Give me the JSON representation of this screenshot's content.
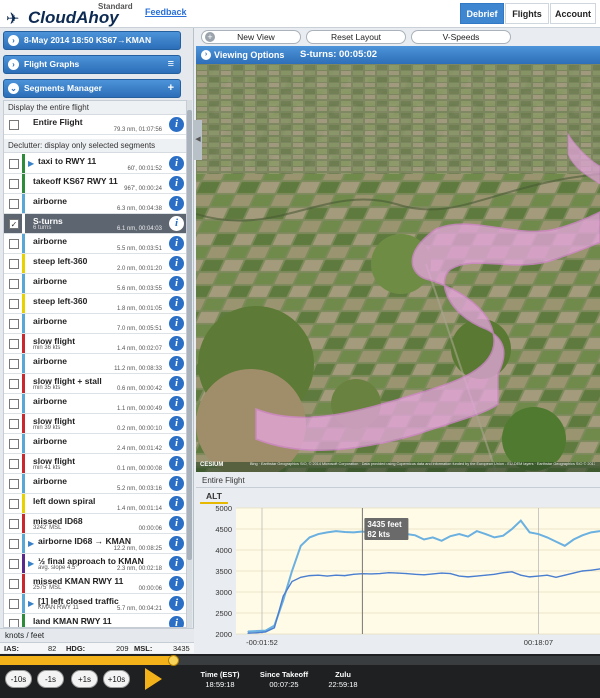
{
  "header": {
    "logo_standard": "Standard",
    "logo_name": "CloudAhoy",
    "feedback": "Feedback",
    "nav": [
      "Debrief",
      "Flights",
      "Account"
    ]
  },
  "left": {
    "flight_bar": "8-May 2014 18:50   KS67→KMAN",
    "graphs_bar": "Flight Graphs",
    "segments_bar": "Segments Manager",
    "display_entire": "Display the entire flight",
    "declutter": "Declutter: display only selected segments",
    "entire": {
      "name": "Entire Flight",
      "stat": "79.3 nm, 01:07:56"
    },
    "segments": [
      {
        "name": "taxi to RWY 11",
        "sub": "",
        "stat": "60', 00:01:52",
        "color": "#2e8b3c",
        "arrow": true,
        "checked": false,
        "selected": false
      },
      {
        "name": "takeoff KS67 RWY 11",
        "sub": "",
        "stat": "967', 00:00:24",
        "color": "#2e8b3c",
        "arrow": false,
        "checked": false,
        "selected": false
      },
      {
        "name": "airborne",
        "sub": "",
        "stat": "6.3 nm, 00:04:38",
        "color": "#5aa7d6",
        "arrow": false,
        "checked": false,
        "selected": false
      },
      {
        "name": "S-turns",
        "sub": "6 turns",
        "stat": "6.1 nm, 00:04:03",
        "color": "#ffffff",
        "arrow": false,
        "checked": true,
        "selected": true
      },
      {
        "name": "airborne",
        "sub": "",
        "stat": "5.5 nm, 00:03:51",
        "color": "#5aa7d6",
        "arrow": false,
        "checked": false,
        "selected": false
      },
      {
        "name": "steep left-360",
        "sub": "",
        "stat": "2.0 nm, 00:01:20",
        "color": "#e8d100",
        "arrow": false,
        "checked": false,
        "selected": false
      },
      {
        "name": "airborne",
        "sub": "",
        "stat": "5.6 nm, 00:03:55",
        "color": "#5aa7d6",
        "arrow": false,
        "checked": false,
        "selected": false
      },
      {
        "name": "steep left-360",
        "sub": "",
        "stat": "1.8 nm, 00:01:05",
        "color": "#e8d100",
        "arrow": false,
        "checked": false,
        "selected": false
      },
      {
        "name": "airborne",
        "sub": "",
        "stat": "7.0 nm, 00:05:51",
        "color": "#5aa7d6",
        "arrow": false,
        "checked": false,
        "selected": false
      },
      {
        "name": "slow flight",
        "sub": "min 36 kts",
        "stat": "1.4 nm, 00:02:07",
        "color": "#c8282e",
        "arrow": false,
        "checked": false,
        "selected": false
      },
      {
        "name": "airborne",
        "sub": "",
        "stat": "11.2 nm, 00:08:33",
        "color": "#5aa7d6",
        "arrow": false,
        "checked": false,
        "selected": false
      },
      {
        "name": "slow flight + stall",
        "sub": "min 35 kts",
        "stat": "0.6 nm, 00:00:42",
        "color": "#c8282e",
        "arrow": false,
        "checked": false,
        "selected": false
      },
      {
        "name": "airborne",
        "sub": "",
        "stat": "1.1 nm, 00:00:49",
        "color": "#5aa7d6",
        "arrow": false,
        "checked": false,
        "selected": false
      },
      {
        "name": "slow flight",
        "sub": "min 39 kts",
        "stat": "0.2 nm, 00:00:10",
        "color": "#c8282e",
        "arrow": false,
        "checked": false,
        "selected": false
      },
      {
        "name": "airborne",
        "sub": "",
        "stat": "2.4 nm, 00:01:42",
        "color": "#5aa7d6",
        "arrow": false,
        "checked": false,
        "selected": false
      },
      {
        "name": "slow flight",
        "sub": "min 41 kts",
        "stat": "0.1 nm, 00:00:08",
        "color": "#c8282e",
        "arrow": false,
        "checked": false,
        "selected": false
      },
      {
        "name": "airborne",
        "sub": "",
        "stat": "5.2 nm, 00:03:16",
        "color": "#5aa7d6",
        "arrow": false,
        "checked": false,
        "selected": false
      },
      {
        "name": "left down spiral",
        "sub": "",
        "stat": "1.4 nm, 00:01:14",
        "color": "#e8d100",
        "arrow": false,
        "checked": false,
        "selected": false
      },
      {
        "name": "missed ID68",
        "sub": "3242' MSL",
        "stat": "00:00:06",
        "color": "#c8282e",
        "arrow": false,
        "checked": false,
        "selected": false
      },
      {
        "name": "airborne ID68 → KMAN",
        "sub": "",
        "stat": "12.2 nm, 00:08:25",
        "color": "#5aa7d6",
        "arrow": true,
        "checked": false,
        "selected": false
      },
      {
        "name": "½ final approach to KMAN",
        "sub": "avg. slope 4.5°",
        "stat": "2.3 nm, 00:02:18",
        "color": "#5a2a8a",
        "arrow": true,
        "checked": false,
        "selected": false
      },
      {
        "name": "missed KMAN RWY 11",
        "sub": "2575' MSL",
        "stat": "00:00:06",
        "color": "#c8282e",
        "arrow": false,
        "checked": false,
        "selected": false
      },
      {
        "name": "[1] left closed traffic",
        "sub": "KMAN RWY 11",
        "stat": "5.7 nm, 00:04:21",
        "color": "#5aa7d6",
        "arrow": true,
        "checked": false,
        "selected": false
      },
      {
        "name": "land KMAN RWY 11",
        "sub": "",
        "stat": "",
        "color": "#2e8b3c",
        "arrow": false,
        "checked": false,
        "selected": false
      }
    ],
    "units": "knots / feet",
    "readout": {
      "ias_label": "IAS:",
      "ias": "82",
      "hdg_label": "HDG:",
      "hdg": "209",
      "msl_label": "MSL:",
      "msl": "3435"
    }
  },
  "view": {
    "new_view": "New View",
    "reset_layout": "Reset Layout",
    "vspeeds": "V-Speeds",
    "viewing_options": "Viewing Options",
    "title": "S-turns: 00:05:02",
    "cesium": "CESIUM",
    "credit": "Bing · Earthstar Geographics SIO, © 2014 Microsoft Corporation · Data provided using Copernicus data and information funded by the European Union - EU-DEM layers · Earthstar Geographics SIO © 2017 Microsoft Corp."
  },
  "graph": {
    "header": "Entire Flight",
    "tab": "ALT",
    "tooltip_alt": "3435 feet",
    "tooltip_spd": "82 kts"
  },
  "timeline": {
    "buttons": [
      "-10s",
      "-1s",
      "+1s",
      "+10s"
    ],
    "time_label": "Time (EST)",
    "time_value": "18:59:18",
    "since_label": "Since Takeoff",
    "since_value": "00:07:25",
    "zulu_label": "Zulu",
    "zulu_value": "22:59:18",
    "progress": 0.29
  },
  "chart_data": {
    "type": "line",
    "ylim": [
      2000,
      5000
    ],
    "yticks": [
      2000,
      2500,
      3000,
      3500,
      4000,
      4500,
      5000
    ],
    "xtick_labels": [
      "-00:01:52",
      "00:18:07"
    ],
    "cursor_label": "3435 feet / 82 kts",
    "series": [
      {
        "key": "altitude",
        "color": "#6ab0e0",
        "x": [
          0,
          1,
          2,
          3,
          4,
          5,
          6,
          7,
          8,
          9,
          10,
          11,
          12,
          13,
          14,
          15,
          16,
          17,
          18,
          19,
          20,
          21,
          22,
          23,
          24,
          25,
          26,
          27,
          28,
          29,
          30,
          31,
          32,
          33,
          34,
          35,
          36,
          37,
          38,
          39,
          40
        ],
        "y": [
          2060,
          2070,
          2080,
          2200,
          2800,
          3500,
          4100,
          4300,
          4380,
          4420,
          4450,
          4430,
          4420,
          4440,
          4410,
          4350,
          4300,
          4420,
          4380,
          4350,
          4250,
          4300,
          4220,
          4330,
          4380,
          4320,
          4450,
          4380,
          4300,
          4340,
          4500,
          4700,
          4420,
          4380,
          4300,
          4200,
          4100,
          4250,
          4350,
          4420,
          4450
        ]
      },
      {
        "key": "speed",
        "color": "#4a7ed0",
        "x": [
          0,
          1,
          2,
          3,
          4,
          5,
          6,
          7,
          8,
          9,
          10,
          11,
          12,
          13,
          14,
          15,
          16,
          17,
          18,
          19,
          20,
          21,
          22,
          23,
          24,
          25,
          26,
          27,
          28,
          29,
          30,
          31,
          32,
          33,
          34,
          35,
          36,
          37,
          38,
          39,
          40
        ],
        "y": [
          2020,
          2030,
          2050,
          2150,
          2900,
          3250,
          3350,
          3390,
          3400,
          3380,
          3400,
          3390,
          3420,
          3435,
          3430,
          3440,
          3460,
          3450,
          3440,
          3420,
          3410,
          3430,
          3450,
          3440,
          3380,
          3360,
          3380,
          3400,
          3420,
          3460,
          3480,
          3400,
          3360,
          3380,
          3400,
          3350,
          3400,
          3450,
          3500,
          3520,
          3550
        ]
      }
    ]
  }
}
